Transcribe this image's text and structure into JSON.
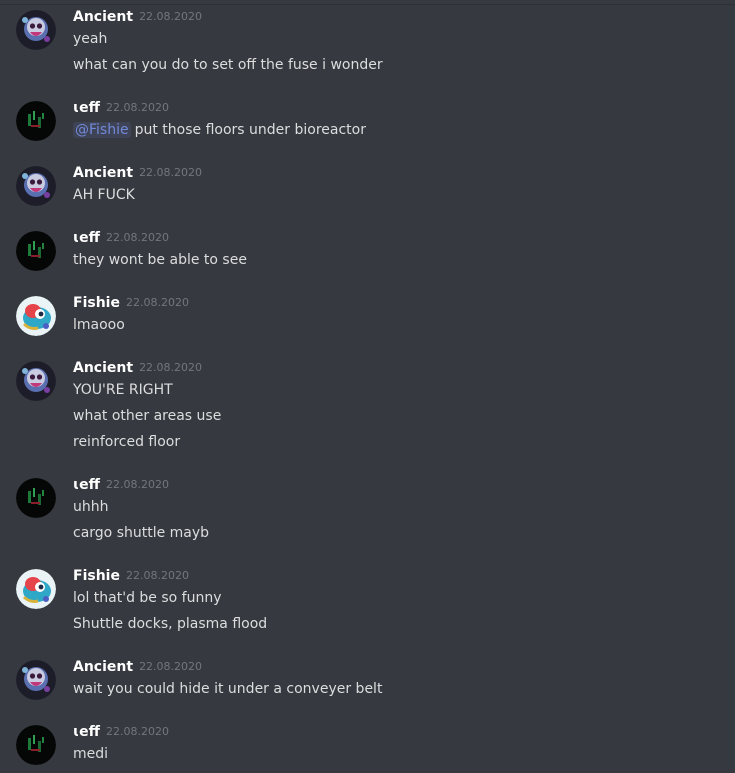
{
  "messages": [
    {
      "author": "Ancient",
      "avatar": "skull-purple-avatar",
      "timestamp": "22.08.2020",
      "lines": [
        "yeah",
        "what can you do to set off the fuse i wonder"
      ]
    },
    {
      "author": "ɩeff",
      "avatar": "dark-green-avatar",
      "timestamp": "22.08.2020",
      "mention": "@Fishie",
      "lines": [
        "put those floors under bioreactor"
      ]
    },
    {
      "author": "Ancient",
      "avatar": "skull-purple-avatar",
      "timestamp": "22.08.2020",
      "lines": [
        "AH FUCK"
      ]
    },
    {
      "author": "ɩeff",
      "avatar": "dark-green-avatar",
      "timestamp": "22.08.2020",
      "lines": [
        "they wont be able to see"
      ]
    },
    {
      "author": "Fishie",
      "avatar": "fish-colorful-avatar",
      "timestamp": "22.08.2020",
      "lines": [
        "lmaooo"
      ]
    },
    {
      "author": "Ancient",
      "avatar": "skull-purple-avatar",
      "timestamp": "22.08.2020",
      "lines": [
        "YOU'RE RIGHT",
        "what other areas use",
        "reinforced floor"
      ]
    },
    {
      "author": "ɩeff",
      "avatar": "dark-green-avatar",
      "timestamp": "22.08.2020",
      "lines": [
        "uhhh",
        "cargo shuttle mayb"
      ]
    },
    {
      "author": "Fishie",
      "avatar": "fish-colorful-avatar",
      "timestamp": "22.08.2020",
      "lines": [
        "lol that'd be so funny",
        "Shuttle docks, plasma flood"
      ]
    },
    {
      "author": "Ancient",
      "avatar": "skull-purple-avatar",
      "timestamp": "22.08.2020",
      "lines": [
        "wait you could hide it under a conveyer belt"
      ]
    },
    {
      "author": "ɩeff",
      "avatar": "dark-green-avatar",
      "timestamp": "22.08.2020",
      "lines": [
        "medi"
      ]
    }
  ],
  "colors": {
    "background": "#36393f",
    "username": "#ffffff",
    "timestamp": "#72767d",
    "text": "#dcddde",
    "mention": "#7289da"
  }
}
